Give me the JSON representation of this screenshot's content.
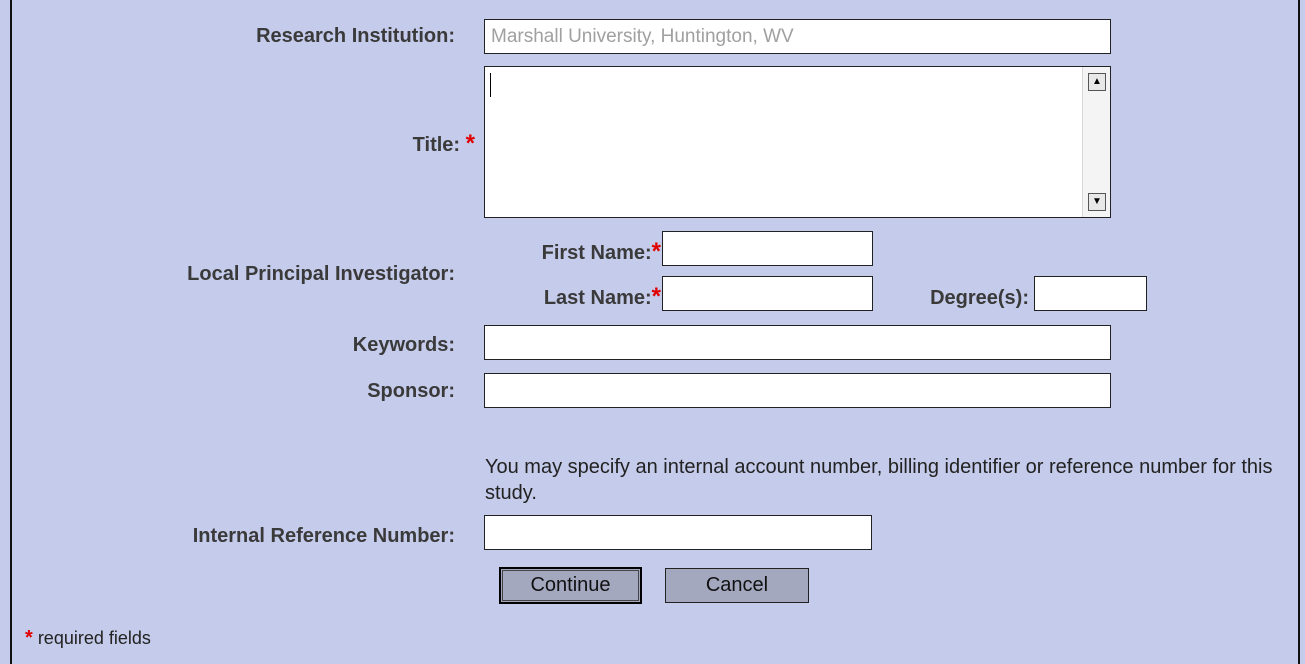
{
  "form": {
    "institution": {
      "label": "Research Institution:",
      "value": "Marshall University, Huntington, WV"
    },
    "title": {
      "label": "Title:",
      "required_mark": "*",
      "value": ""
    },
    "pi": {
      "label": "Local Principal Investigator:",
      "first_name_label": "First Name:",
      "last_name_label": "Last Name:",
      "degrees_label": "Degree(s):",
      "required_mark": "*",
      "first_name": "",
      "last_name": "",
      "degrees": ""
    },
    "keywords": {
      "label": "Keywords:",
      "value": ""
    },
    "sponsor": {
      "label": "Sponsor:",
      "value": ""
    },
    "reference_note": "You may specify an internal account number, billing identifier or reference number for this study.",
    "reference": {
      "label": "Internal Reference Number:",
      "value": ""
    },
    "continue_label": "Continue",
    "cancel_label": "Cancel",
    "footer": {
      "mark": "*",
      "text": "required fields"
    }
  },
  "icons": {
    "scroll_up": "triangle-up-icon",
    "scroll_down": "triangle-down-icon"
  }
}
